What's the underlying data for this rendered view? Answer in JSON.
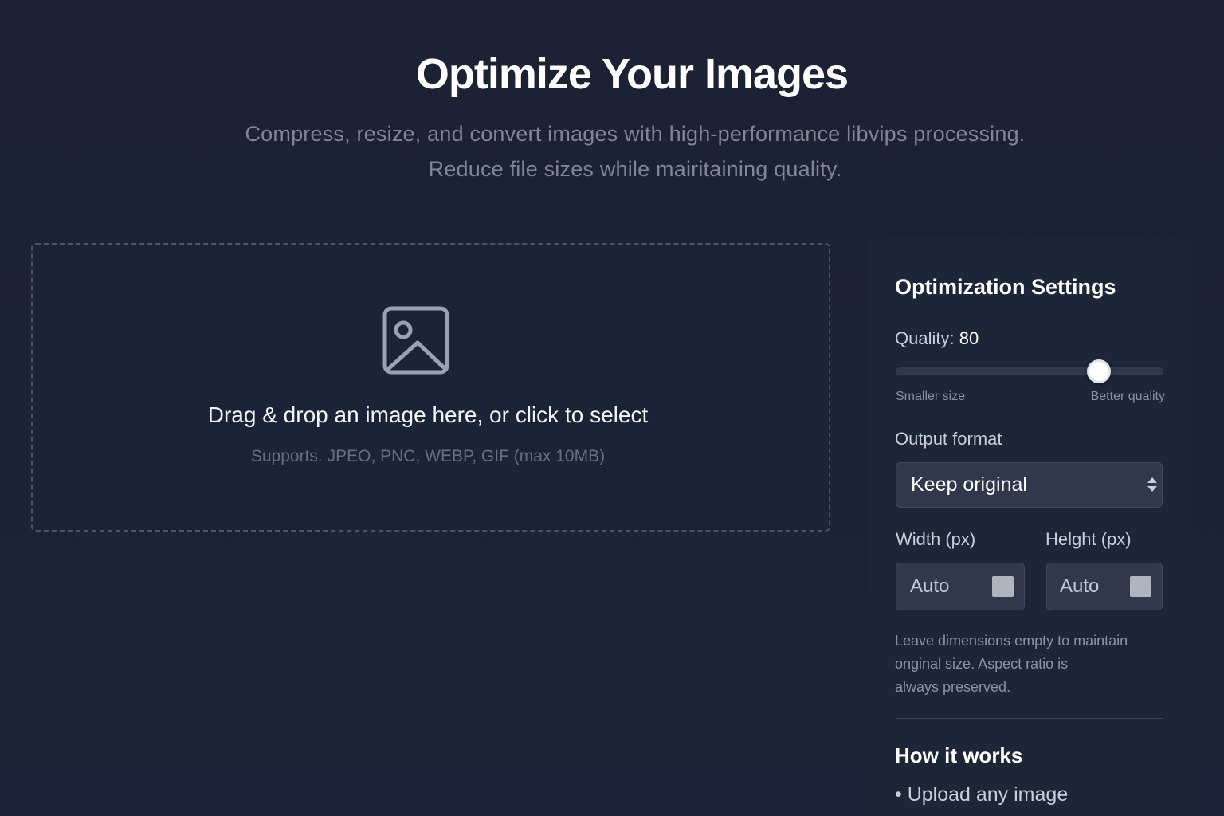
{
  "header": {
    "title": "Optimize Your Images",
    "subtitle_line1": "Compress, resize, and convert images with high-performance libvips processing.",
    "subtitle_line2": "Reduce file sizes while mairitaining quality."
  },
  "dropzone": {
    "icon": "image-icon",
    "main_text": "Drag & drop an image here, or click to select",
    "sub_text": "Supports. JPEO, PNC, WEBP, GIF (max 10MB)"
  },
  "settings": {
    "title": "Optimization Settings",
    "quality_label": "Quality:",
    "quality_value": "80",
    "slider_min_label": "Smaller size",
    "slider_max_label": "Better quality",
    "format_label": "Output format",
    "format_selected": "Keep original",
    "width_label": "Width (px)",
    "width_placeholder": "Auto",
    "height_label": "Helght (px)",
    "height_placeholder": "Auto",
    "hint_line1": "Leave dimensions empty to maintain",
    "hint_line2": "onginal size. Aspect ratio is",
    "hint_line3": "always preserved."
  },
  "how_it_works": {
    "title": "How it works",
    "items": [
      "Upload any image"
    ]
  },
  "colors": {
    "background": "#1b2435",
    "panel": "#1d2637",
    "input": "#2f394b",
    "text_muted": "#7f8797"
  }
}
